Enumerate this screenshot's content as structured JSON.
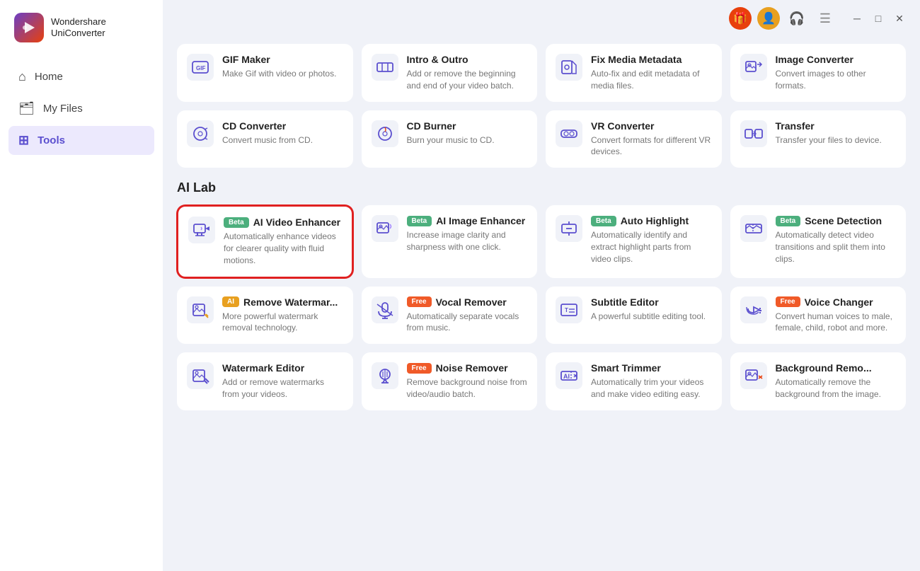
{
  "app": {
    "name": "Wondershare",
    "product": "UniConverter"
  },
  "sidebar": {
    "items": [
      {
        "id": "home",
        "label": "Home",
        "icon": "🏠",
        "active": false
      },
      {
        "id": "myfiles",
        "label": "My Files",
        "icon": "📁",
        "active": false
      },
      {
        "id": "tools",
        "label": "Tools",
        "icon": "🧰",
        "active": true
      }
    ]
  },
  "topbar": {
    "gift_icon": "🎁",
    "user_icon": "👤",
    "headset_icon": "🎧",
    "menu_icon": "☰"
  },
  "sections": [
    {
      "id": "tools",
      "title": "",
      "cards": [
        {
          "id": "gif-maker",
          "title": "GIF Maker",
          "desc": "Make Gif with video or photos.",
          "badge": null,
          "icon": "gif",
          "selected": false
        },
        {
          "id": "intro-outro",
          "title": "Intro & Outro",
          "desc": "Add or remove the beginning and end of your video batch.",
          "badge": null,
          "icon": "intro",
          "selected": false
        },
        {
          "id": "fix-media",
          "title": "Fix Media Metadata",
          "desc": "Auto-fix and edit metadata of media files.",
          "badge": null,
          "icon": "fix",
          "selected": false
        },
        {
          "id": "image-converter",
          "title": "Image Converter",
          "desc": "Convert images to other formats.",
          "badge": null,
          "icon": "img-conv",
          "selected": false
        },
        {
          "id": "cd-converter",
          "title": "CD Converter",
          "desc": "Convert music from CD.",
          "badge": null,
          "icon": "cd",
          "selected": false
        },
        {
          "id": "cd-burner",
          "title": "CD Burner",
          "desc": "Burn your music to CD.",
          "badge": null,
          "icon": "cd-burn",
          "selected": false
        },
        {
          "id": "vr-converter",
          "title": "VR Converter",
          "desc": "Convert formats for different VR devices.",
          "badge": null,
          "icon": "vr",
          "selected": false
        },
        {
          "id": "transfer",
          "title": "Transfer",
          "desc": "Transfer your files to device.",
          "badge": null,
          "icon": "transfer",
          "selected": false
        }
      ]
    },
    {
      "id": "ai-lab",
      "title": "AI Lab",
      "cards": [
        {
          "id": "ai-video-enhancer",
          "title": "AI Video Enhancer",
          "desc": "Automatically enhance videos for clearer quality with fluid motions.",
          "badge": "Beta",
          "badge_type": "beta",
          "icon": "video-enhance",
          "selected": true
        },
        {
          "id": "ai-image-enhancer",
          "title": "AI Image Enhancer",
          "desc": "Increase image clarity and sharpness with one click.",
          "badge": "Beta",
          "badge_type": "beta",
          "icon": "img-enhance",
          "selected": false
        },
        {
          "id": "auto-highlight",
          "title": "Auto Highlight",
          "desc": "Automatically identify and extract highlight parts from video clips.",
          "badge": "Beta",
          "badge_type": "beta",
          "icon": "highlight",
          "selected": false
        },
        {
          "id": "scene-detection",
          "title": "Scene Detection",
          "desc": "Automatically detect video transitions and split them into clips.",
          "badge": "Beta",
          "badge_type": "beta",
          "icon": "scene",
          "selected": false
        },
        {
          "id": "remove-watermark",
          "title": "Remove Watermar...",
          "desc": "More powerful watermark removal technology.",
          "badge": "AI",
          "badge_type": "ai",
          "icon": "watermark-remove",
          "selected": false
        },
        {
          "id": "vocal-remover",
          "title": "Vocal Remover",
          "desc": "Automatically separate vocals from music.",
          "badge": "Free",
          "badge_type": "free",
          "icon": "vocal",
          "selected": false
        },
        {
          "id": "subtitle-editor",
          "title": "Subtitle Editor",
          "desc": "A powerful subtitle editing tool.",
          "badge": null,
          "icon": "subtitle",
          "selected": false
        },
        {
          "id": "voice-changer",
          "title": "Voice Changer",
          "desc": "Convert human voices to male, female, child, robot and more.",
          "badge": "Free",
          "badge_type": "free",
          "icon": "voice-change",
          "selected": false
        },
        {
          "id": "watermark-editor",
          "title": "Watermark Editor",
          "desc": "Add or remove watermarks from your videos.",
          "badge": null,
          "icon": "watermark-edit",
          "selected": false
        },
        {
          "id": "noise-remover",
          "title": "Noise Remover",
          "desc": "Remove background noise from video/audio batch.",
          "badge": "Free",
          "badge_type": "free",
          "icon": "noise",
          "selected": false
        },
        {
          "id": "smart-trimmer",
          "title": "Smart Trimmer",
          "desc": "Automatically trim your videos and make video editing easy.",
          "badge": null,
          "icon": "trim",
          "selected": false
        },
        {
          "id": "background-remover",
          "title": "Background Remo...",
          "desc": "Automatically remove the background from the image.",
          "badge": null,
          "icon": "bg-remove",
          "selected": false
        }
      ]
    }
  ]
}
